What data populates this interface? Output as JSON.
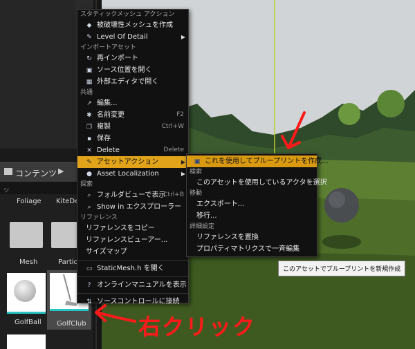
{
  "content_browser": {
    "tab_label": "コンテンツ",
    "search_fragment": "ッ",
    "assets": [
      {
        "label": "Foliage"
      },
      {
        "label": "KiteDem"
      },
      {
        "label": "Mesh"
      },
      {
        "label": "Particle"
      },
      {
        "label": "GolfBall"
      },
      {
        "label": "GolfClub"
      }
    ]
  },
  "context_menu": {
    "sections": {
      "static_mesh": "スタティックメッシュ アクション",
      "import": "インポートアセット",
      "common": "共通",
      "search": "探索",
      "reference": "リファレンス"
    },
    "items": {
      "nondestructive": "被破壊性メッシュを作成",
      "lod": "Level Of Detail",
      "reimport": "再インポート",
      "open_source": "ソース位置を開く",
      "open_external": "外部エディタで開く",
      "edit": "編集...",
      "rename": "名前変更",
      "rename_sc": "F2",
      "duplicate": "複製",
      "duplicate_sc": "Ctrl+W",
      "save": "保存",
      "delete": "Delete",
      "delete_sc": "Delete",
      "asset_actions": "アセットアクション",
      "asset_localization": "Asset Localization",
      "folder_view": "フォルダビューで表示",
      "folder_view_sc": "Ctrl+B",
      "show_explorer": "Show in エクスプローラー",
      "copy_reference": "リファレンスをコピー",
      "reference_viewer": "リファレンスビューアー...",
      "size_map": "サイズマップ",
      "open_header": "StaticMesh.h を開く",
      "online_manual": "オンラインマニュアルを表示",
      "source_control": "ソースコントロールに接続"
    }
  },
  "submenu": {
    "create_blueprint": "これを使用してブループリントを作成...",
    "search_section": "検索",
    "select_actors": "このアセットを使用しているアクタを選択",
    "move_section": "移動",
    "export": "エクスポート...",
    "migrate": "移行...",
    "advanced_section": "詳細設定",
    "replace_refs": "リファレンスを置換",
    "property_matrix": "プロパティマトリクスで一斉編集"
  },
  "tooltip": "このアセットでブループリントを新規作成",
  "annotation": {
    "right_click": "右クリック"
  },
  "colors": {
    "highlight": "#e0a31a",
    "annotation_red": "#ff1a1a"
  }
}
